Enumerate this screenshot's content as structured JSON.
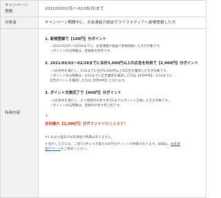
{
  "rows": [
    {
      "label_line1": "キャンペーン",
      "label_line2": "期間",
      "value": "2021/02/01(月)〜02/28(日)まで"
    },
    {
      "label": "対象者",
      "value": "キャンペーン期間中に、お友達紹介経由でライフメディアへ新規登録した方"
    },
    {
      "label": "特典内容"
    }
  ],
  "section1": {
    "heading_prefix": "1. ",
    "heading": "新規登録で【100円】分ポイント",
    "bullets": [
      "・2021/02/01〜02/28までに、お友達紹介経由で新規登録した方が対象です。",
      "・ポイント付与時期は、登録後の翌月です。"
    ]
  },
  "section2": {
    "heading_prefix": "2. ",
    "heading": "2021/02/01〜02/28までに合計5,000円以上の広告を利用で【2,000円】分ポイント",
    "bullets": [
      "・1の条件を満たし、5/10までに合計5,000円以上の広告を獲得した方が対象です。",
      "・ポイント付与時期は、4/10までに広告獲得を確認した方は【4月中旬】、5/10までに",
      "  広告ポイントを獲得した方は【5月中旬】となります。"
    ]
  },
  "section3": {
    "heading_prefix": "3. ",
    "heading": "ポイント交換完了で【400円】分ポイント",
    "bullets": [
      "・1の条件を満たし、かつ登録月の翌々月7日までにポイント交換した方が対象です。",
      "・ポイント付与時期は、登録月の翌々月上旬です。"
    ]
  },
  "arrow": "↓",
  "total": {
    "prefix": "合計最大【2,500円】分ポイント",
    "suffix": "がもらえます！"
  },
  "notes": {
    "note1": "※1 および過去のお友達紹介特典はありません。",
    "note2_line1": "※ 紹介した方には、ご紹介1件につき最大500円分ポイントの特典があります。詳細は、",
    "note2_link_a": "お友達",
    "note2_link_b": "紹介ページ",
    "note2_tail": "をご確認ください。"
  }
}
